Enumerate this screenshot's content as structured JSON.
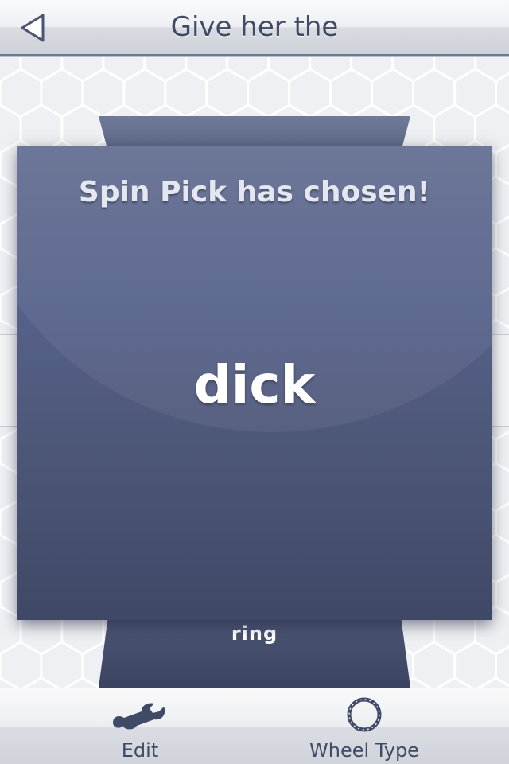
{
  "navbar": {
    "title": "Give her the",
    "back_icon": "back-arrow-icon"
  },
  "wheel": {
    "visible_item_below": "ring"
  },
  "result_card": {
    "heading": "Spin Pick has chosen!",
    "result": "dick"
  },
  "toolbar": {
    "items": [
      {
        "label": "Edit",
        "icon": "wrench-icon"
      },
      {
        "label": "Wheel Type",
        "icon": "ring-icon"
      }
    ]
  },
  "colors": {
    "accent": "#3f4b66",
    "card": "#56618a",
    "background": "#eceef1"
  }
}
